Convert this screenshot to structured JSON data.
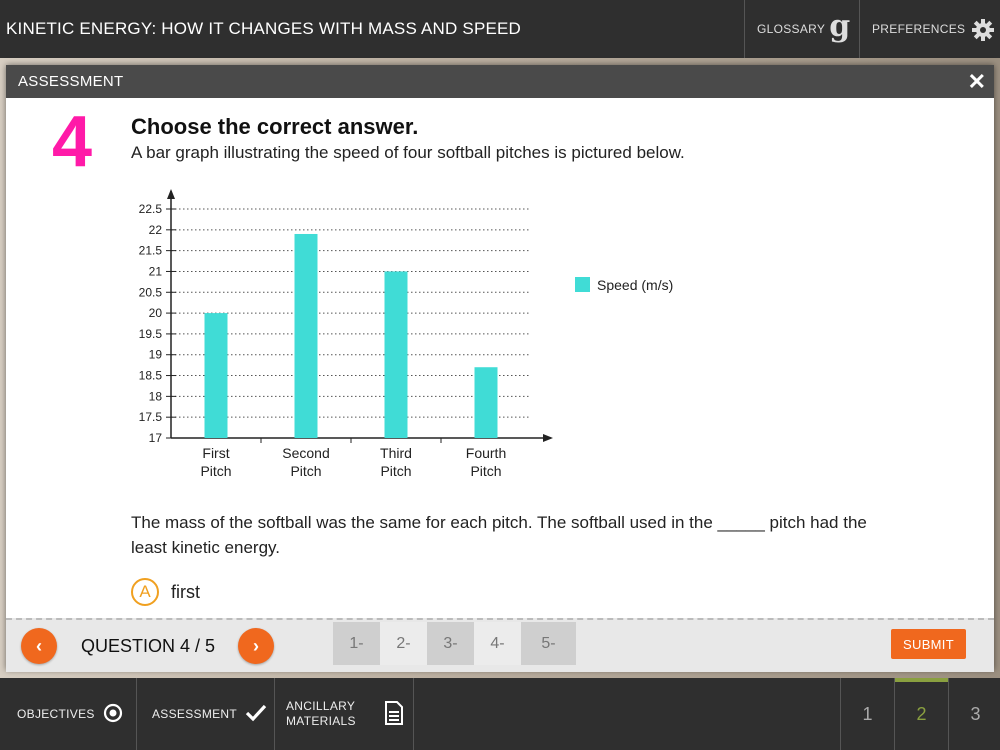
{
  "topbar": {
    "title": "KINETIC ENERGY: HOW IT CHANGES WITH MASS AND SPEED",
    "glossary_label": "GLOSSARY",
    "glossary_glyph": "g",
    "preferences_label": "PREFERENCES"
  },
  "modal": {
    "title": "ASSESSMENT",
    "close_glyph": "✕"
  },
  "question": {
    "number": "4",
    "heading": "Choose the correct answer.",
    "intro": "A bar graph illustrating the speed of four softball pitches is pictured below.",
    "stem": "The mass of the softball was the same for each pitch. The softball used in the _____ pitch had the least kinetic energy.",
    "choices": [
      {
        "letter": "A",
        "text": "first"
      }
    ]
  },
  "chart_data": {
    "type": "bar",
    "categories": [
      [
        "First",
        "Pitch"
      ],
      [
        "Second",
        "Pitch"
      ],
      [
        "Third",
        "Pitch"
      ],
      [
        "Fourth",
        "Pitch"
      ]
    ],
    "series": [
      {
        "name": "Speed (m/s)",
        "values": [
          20,
          21.9,
          21,
          18.7
        ]
      }
    ],
    "ylim": [
      17,
      22.5
    ],
    "yticks": [
      "17",
      "17.5",
      "18",
      "18.5",
      "19",
      "19.5",
      "20",
      "20.5",
      "21",
      "21.5",
      "22",
      "22.5"
    ],
    "bar_color": "#40dcd6",
    "grid": "dotted",
    "legend_position": "right"
  },
  "footer": {
    "prev_glyph": "‹",
    "next_glyph": "›",
    "question_count": "QUESTION 4 / 5",
    "pages": [
      "1-",
      "2-",
      "3-",
      "4-",
      "5-"
    ],
    "submit_label": "SUBMIT"
  },
  "bottombar": {
    "objectives_label": "OBJECTIVES",
    "assessment_label": "ASSESSMENT",
    "ancillary_line1": "ANCILLARY",
    "ancillary_line2": "MATERIALS",
    "pages": [
      "1",
      "2",
      "3"
    ],
    "active_page": "2"
  },
  "colors": {
    "accent": "#f0681e",
    "question_number": "#ff1aa8",
    "choice_ring": "#f0a020",
    "active_page": "#8aa040"
  }
}
